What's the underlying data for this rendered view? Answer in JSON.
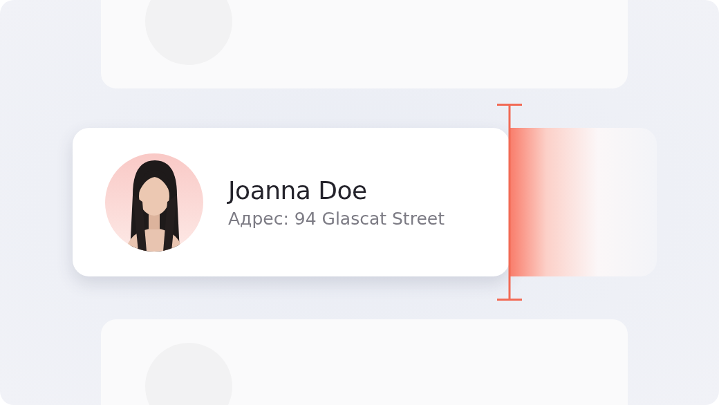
{
  "card": {
    "name": "Joanna Doe",
    "address": "Адрес: 94 Glascat Street"
  }
}
